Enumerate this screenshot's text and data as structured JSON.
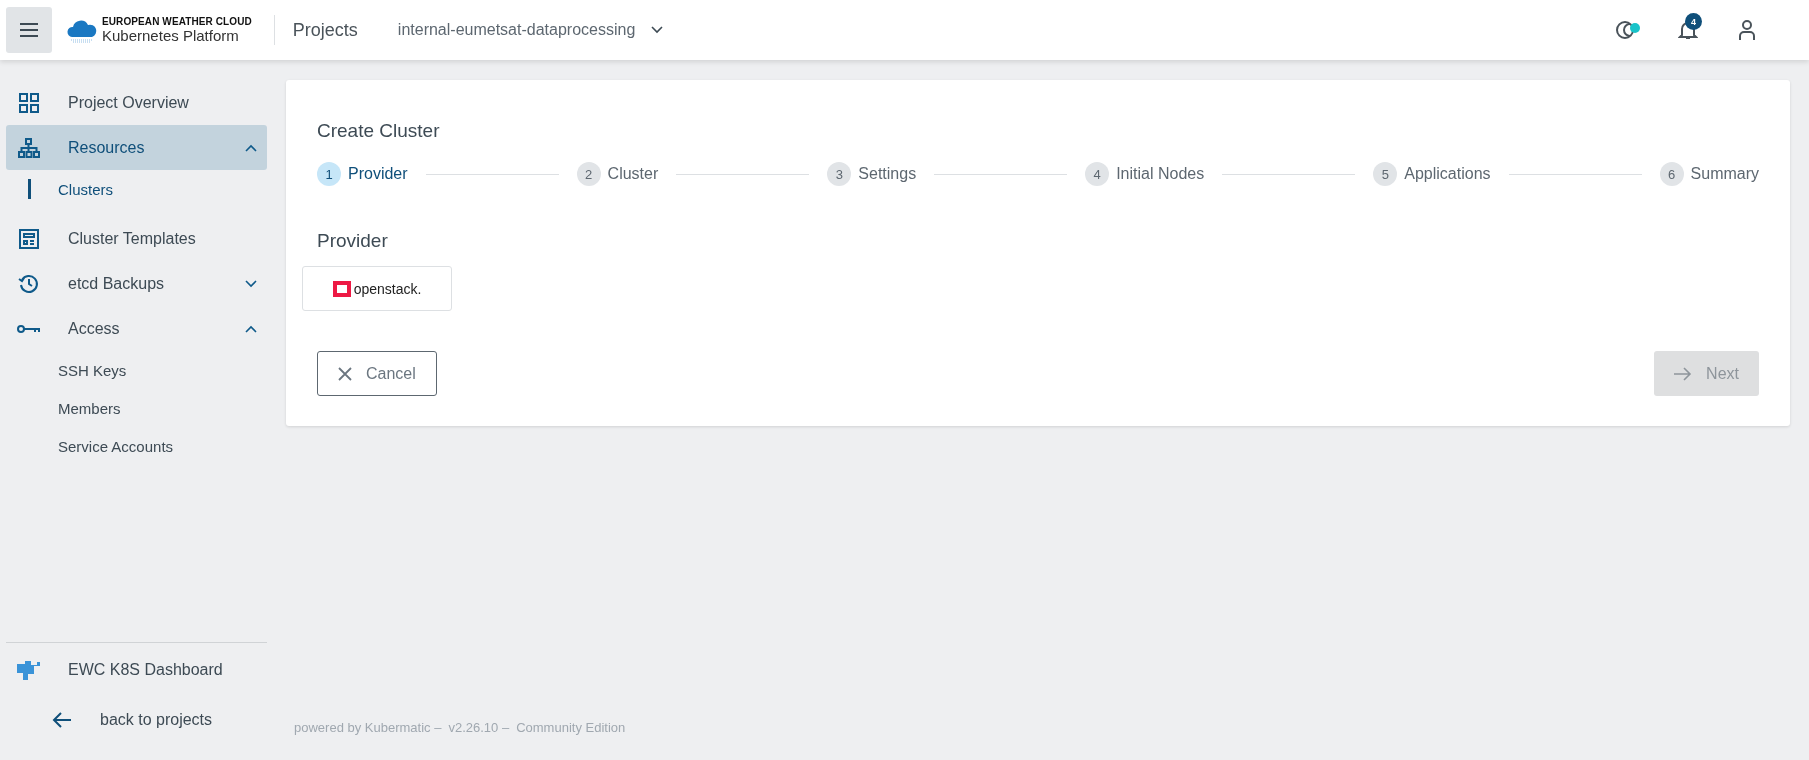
{
  "header": {
    "brand": {
      "line1": "EUROPEAN WEATHER CLOUD",
      "line2": "Kubernetes Platform"
    },
    "section": "Projects",
    "project_selector": {
      "value": "internal-eumetsat-dataprocessing"
    },
    "notifications": {
      "count": "4"
    },
    "theme_status": {
      "on": true
    }
  },
  "sidebar": {
    "items": [
      {
        "kind": "link",
        "label": "Project Overview",
        "selected": false
      },
      {
        "kind": "group",
        "label": "Resources",
        "selected": true,
        "expanded": true,
        "children": [
          {
            "label": "Clusters",
            "selected": true
          }
        ]
      },
      {
        "kind": "link",
        "label": "Cluster Templates",
        "selected": false
      },
      {
        "kind": "group",
        "label": "etcd Backups",
        "selected": false,
        "expanded": false
      },
      {
        "kind": "group",
        "label": "Access",
        "selected": false,
        "expanded": true,
        "children": [
          {
            "label": "SSH Keys",
            "selected": false
          },
          {
            "label": "Members",
            "selected": false
          },
          {
            "label": "Service Accounts",
            "selected": false
          }
        ]
      }
    ],
    "dashboard_link": "EWC K8S Dashboard",
    "back_link": "back to projects"
  },
  "card": {
    "title": "Create Cluster",
    "steps": [
      {
        "number": "1",
        "label": "Provider",
        "selected": true
      },
      {
        "number": "2",
        "label": "Cluster",
        "selected": false
      },
      {
        "number": "3",
        "label": "Settings",
        "selected": false
      },
      {
        "number": "4",
        "label": "Initial Nodes",
        "selected": false
      },
      {
        "number": "5",
        "label": "Applications",
        "selected": false
      },
      {
        "number": "6",
        "label": "Summary",
        "selected": false
      }
    ],
    "section_title": "Provider",
    "providers": [
      {
        "name": "openstack."
      }
    ],
    "buttons": [
      {
        "kind": "cancel",
        "label": "Cancel",
        "disabled": false
      },
      {
        "kind": "next",
        "label": "Next",
        "disabled": true
      }
    ]
  },
  "footer": [
    "powered by Kubermatic –",
    "v2.26.10 –",
    "Community Edition"
  ]
}
